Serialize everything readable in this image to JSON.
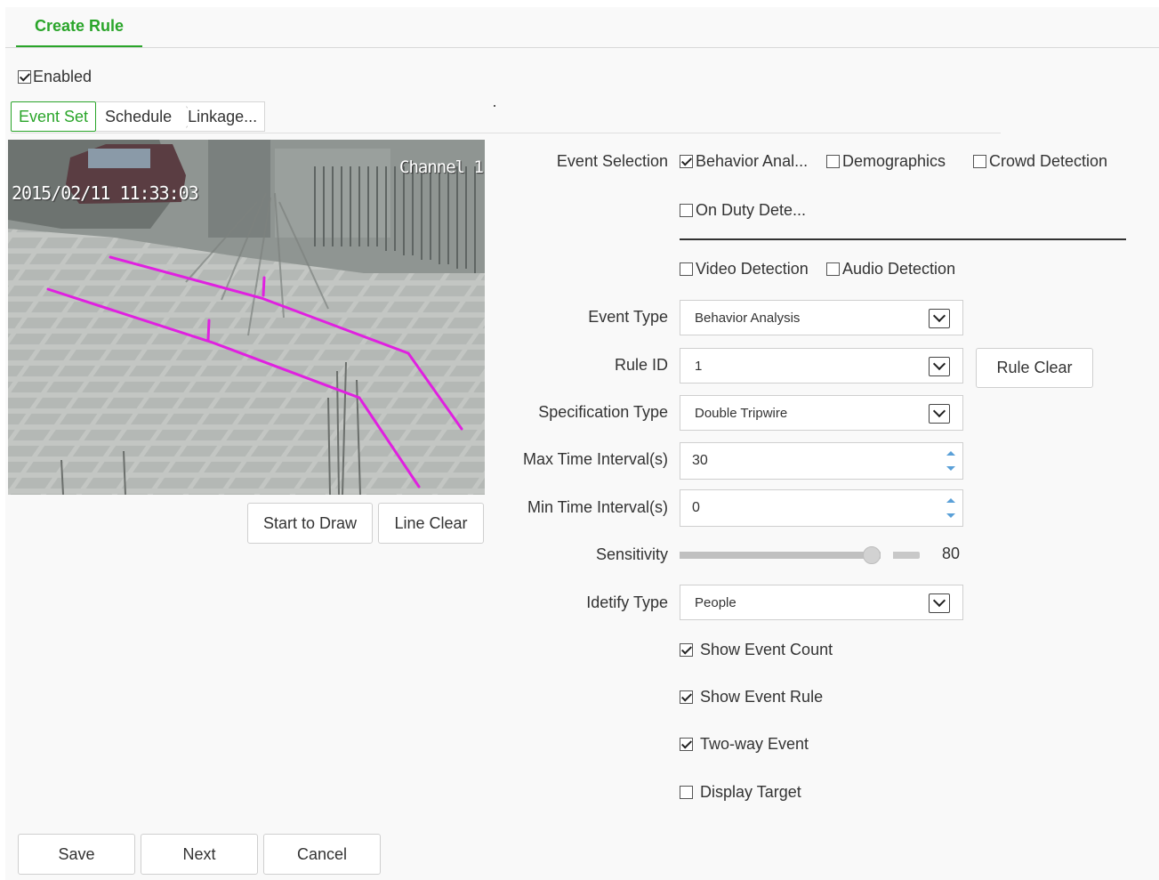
{
  "header": {
    "title": "Create Rule"
  },
  "enabled": {
    "label": "Enabled",
    "checked": true
  },
  "steps": [
    {
      "label": "Event Set",
      "active": true
    },
    {
      "label": "Schedule",
      "active": false
    },
    {
      "label": "Linkage...",
      "active": false
    }
  ],
  "video": {
    "timestamp": "2015/02/11 11:33:03",
    "channel": "Channel 1",
    "line_color": "#e020e0"
  },
  "video_buttons": {
    "start_draw": "Start to Draw",
    "line_clear": "Line Clear"
  },
  "event_selection": {
    "label": "Event Selection",
    "options": [
      {
        "label": "Behavior Anal...",
        "checked": true
      },
      {
        "label": "Demographics",
        "checked": false
      },
      {
        "label": "Crowd Detection",
        "checked": false
      },
      {
        "label": "On Duty Dete...",
        "checked": false
      },
      {
        "label": "Video Detection",
        "checked": false
      },
      {
        "label": "Audio Detection",
        "checked": false
      }
    ]
  },
  "event_type": {
    "label": "Event Type",
    "value": "Behavior Analysis"
  },
  "rule_id": {
    "label": "Rule ID",
    "value": "1",
    "clear_label": "Rule Clear"
  },
  "spec_type": {
    "label": "Specification Type",
    "value": "Double Tripwire"
  },
  "max_interval": {
    "label": "Max Time Interval(s)",
    "value": "30"
  },
  "min_interval": {
    "label": "Min Time Interval(s)",
    "value": "0"
  },
  "sensitivity": {
    "label": "Sensitivity",
    "value": "80",
    "level_percent": 80
  },
  "identify_type": {
    "label": "Idetify Type",
    "value": "People"
  },
  "options": [
    {
      "label": "Show Event Count",
      "checked": true
    },
    {
      "label": "Show Event Rule",
      "checked": true
    },
    {
      "label": "Two-way Event",
      "checked": true
    },
    {
      "label": "Display Target",
      "checked": false
    }
  ],
  "footer": {
    "save": "Save",
    "next": "Next",
    "cancel": "Cancel"
  },
  "colors": {
    "accent": "#2aa52a",
    "spinner": "#5aa0d8"
  }
}
